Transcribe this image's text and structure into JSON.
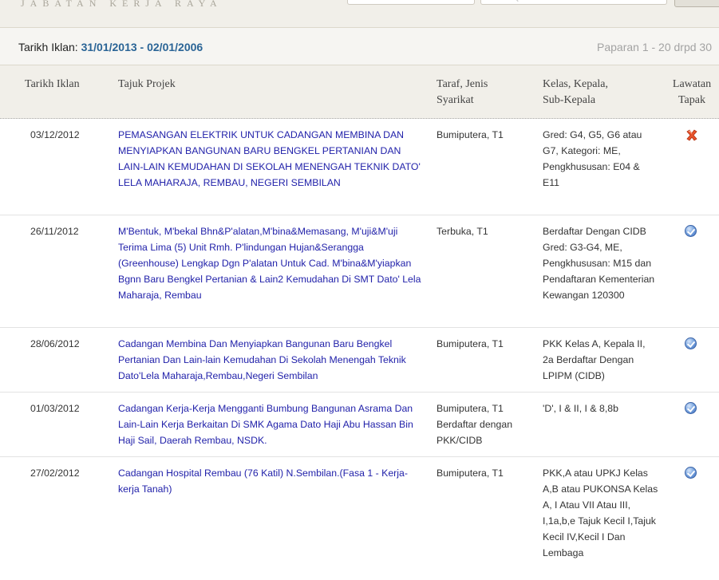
{
  "header": {
    "brand": "JABATAN KERJA RAYA",
    "search_hint": "Q"
  },
  "summary": {
    "label": "Tarikh Iklan:",
    "range": "31/01/2013 - 02/01/2006",
    "count": "Paparan 1 - 20 drpd 30"
  },
  "columns": {
    "tarikh": "Tarikh Iklan",
    "tajuk": "Tajuk Projek",
    "taraf_1": "Taraf, Jenis",
    "taraf_2": "Syarikat",
    "kelas_1": "Kelas, Kepala,",
    "kelas_2": "Sub-Kepala",
    "lawatan_1": "Lawatan",
    "lawatan_2": "Tapak"
  },
  "rows": [
    {
      "date": "03/12/2012",
      "title": "PEMASANGAN ELEKTRIK UNTUK CADANGAN MEMBINA DAN MENYIAPKAN BANGUNAN BARU BENGKEL PERTANIAN DAN LAIN-LAIN KEMUDAHAN DI SEKOLAH MENENGAH TEKNIK DATO' LELA MAHARAJA, REMBAU, NEGERI SEMBILAN",
      "taraf": "Bumiputera, T1",
      "kelas": "Gred: G4, G5, G6 atau G7, Kategori: ME, Pengkhususan: E04 & E11",
      "icon": "cross-icon"
    },
    {
      "date": "26/11/2012",
      "title": "M'Bentuk, M'bekal Bhn&P'alatan,M'bina&Memasang, M'uji&M'uji Terima Lima (5) Unit Rmh. P'lindungan Hujan&Serangga (Greenhouse) Lengkap Dgn P'alatan Untuk Cad. M'bina&M'yiapkan Bgnn Baru Bengkel Pertanian & Lain2 Kemudahan Di SMT Dato' Lela Maharaja, Rembau",
      "taraf": "Terbuka, T1",
      "kelas": "Berdaftar Dengan CIDB Gred: G3-G4, ME, Pengkhususan: M15 dan Pendaftaran Kementerian Kewangan 120300",
      "icon": "check-icon"
    },
    {
      "date": "28/06/2012",
      "title": "Cadangan Membina Dan Menyiapkan Bangunan Baru Bengkel Pertanian Dan Lain-lain Kemudahan Di Sekolah Menengah Teknik Dato'Lela Maharaja,Rembau,Negeri Sembilan",
      "taraf": "Bumiputera, T1",
      "kelas": "PKK Kelas A, Kepala II, 2a Berdaftar Dengan LPIPM (CIDB)",
      "icon": "check-icon"
    },
    {
      "date": "01/03/2012",
      "title": "Cadangan Kerja-Kerja Mengganti Bumbung Bangunan Asrama Dan Lain-Lain Kerja Berkaitan Di SMK Agama Dato Haji Abu Hassan Bin Haji Sail, Daerah Rembau, NSDK.",
      "taraf": "Bumiputera, T1 Berdaftar dengan PKK/CIDB",
      "kelas": "'D', I & II, I & 8,8b",
      "icon": "check-icon"
    },
    {
      "date": "27/02/2012",
      "title": "Cadangan Hospital Rembau (76 Katil) N.Sembilan.(Fasa 1 - Kerja-kerja Tanah)",
      "taraf": "Bumiputera, T1",
      "kelas": "PKK,A atau UPKJ Kelas A,B atau PUKONSA Kelas A, I Atau VII Atau III, I,1a,b,e Tajuk Kecil I,Tajuk Kecil IV,Kecil I Dan Lembaga",
      "icon": "check-icon"
    }
  ]
}
